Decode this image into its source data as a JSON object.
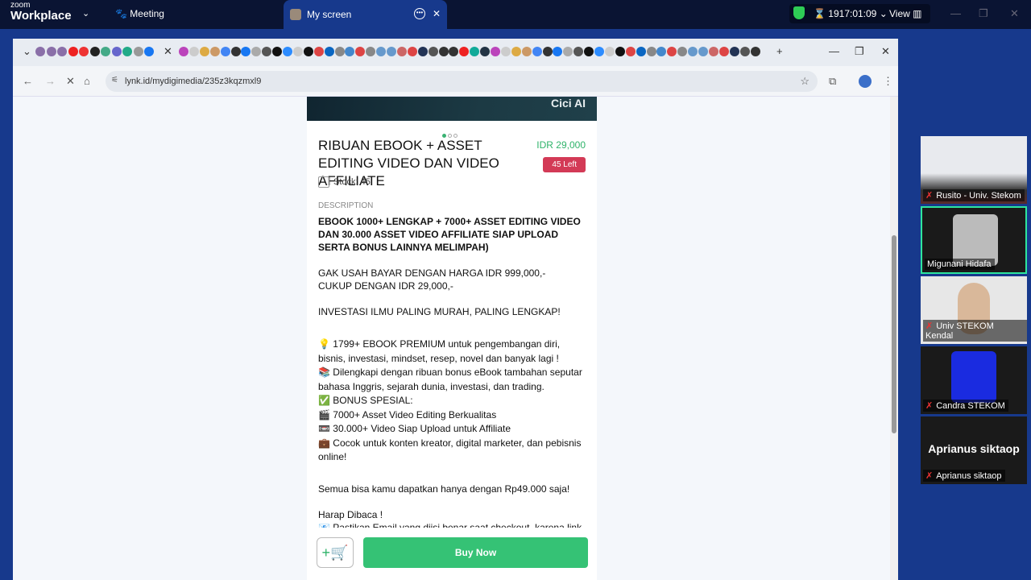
{
  "zoom": {
    "logo_small": "zoom",
    "logo_big": "Workplace",
    "meeting_label": "Meeting",
    "tab_label": "My screen",
    "timer": "1917:01:09",
    "view_label": "View"
  },
  "browser": {
    "url": "lynk.id/mydigimedia/235z3kqzmxl9"
  },
  "product": {
    "banner_text": "Cici AI",
    "title": "RIBUAN EBOOK + ASSET EDITING VIDEO DAN VIDEO AFFILIATE",
    "price": "IDR 29,000",
    "left_badge": "45 Left",
    "stock": "Stock: 45",
    "description_label": "DESCRIPTION",
    "headline": "EBOOK 1000+ LENGKAP + 7000+ ASSET EDITING VIDEO DAN 30.000 ASSET VIDEO AFFILIATE SIAP UPLOAD SERTA BONUS LAINNYA MELIMPAH)",
    "price_line1": "GAK USAH BAYAR DENGAN HARGA IDR 999,000,-",
    "price_line2": "CUKUP DENGAN IDR 29,000,-",
    "tagline": "INVESTASI ILMU PALING MURAH, PALING LENGKAP!",
    "bullets": [
      "💡 1799+ EBOOK PREMIUM untuk pengembangan diri, bisnis, investasi, mindset, resep, novel dan banyak lagi !",
      "📚 Dilengkapi dengan ribuan bonus eBook tambahan seputar bahasa Inggris, sejarah dunia, investasi, dan trading.",
      "✅ BONUS SPESIAL:",
      "🎬 7000+ Asset Video Editing Berkualitas",
      "📼 30.000+ Video Siap Upload untuk Affiliate",
      "💼 Cocok untuk konten kreator, digital marketer, dan pebisnis online!"
    ],
    "offer": "Semua bisa kamu dapatkan hanya dengan Rp49.000 saja!",
    "notice": "Harap Dibaca !",
    "notice_cut": "📧 Pastikan Email yang diisi benar saat checkout, karena link",
    "cart_icon": "+🛒",
    "buy_label": "Buy Now"
  },
  "participants": [
    {
      "name": "Rusito - Univ. Stekom"
    },
    {
      "name": "Migunani Hidafa"
    },
    {
      "name": "Univ STEKOM Kendal"
    },
    {
      "name": "Candra STEKOM"
    },
    {
      "name": "Aprianus siktaop",
      "big": "Aprianus siktaop"
    }
  ],
  "colors": {
    "accent": "#35c275",
    "badge": "#d33a56",
    "speaker": "#2ee59d"
  }
}
